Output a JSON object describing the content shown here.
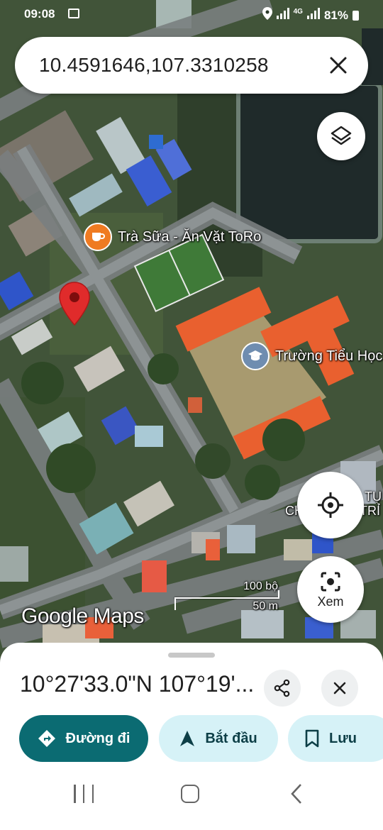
{
  "status_bar": {
    "time": "09:08",
    "network": "4G",
    "battery": "81%"
  },
  "search": {
    "query": "10.4591646,107.3310258"
  },
  "map": {
    "poi_cafe": "Trà Sữa - Ăn Vặt ToRo",
    "poi_school": "Trường Tiểu Học",
    "poi_right_1": "TỤ",
    "poi_right_2": "CH",
    "poi_right_3": "TRỈ",
    "scale_imperial": "100 bộ",
    "scale_metric": "50 m",
    "watermark": "Google Maps",
    "lens_label": "Xem"
  },
  "sheet": {
    "coordinates": "10°27'33.0\"N 107°19'...",
    "directions_label": "Đường đi",
    "start_label": "Bắt đầu",
    "save_label": "Lưu"
  },
  "colors": {
    "teal": "#0b6b72",
    "chip_light": "#d6f2f7",
    "pin_red": "#e02b2b",
    "roof_orange": "#e9602f"
  }
}
